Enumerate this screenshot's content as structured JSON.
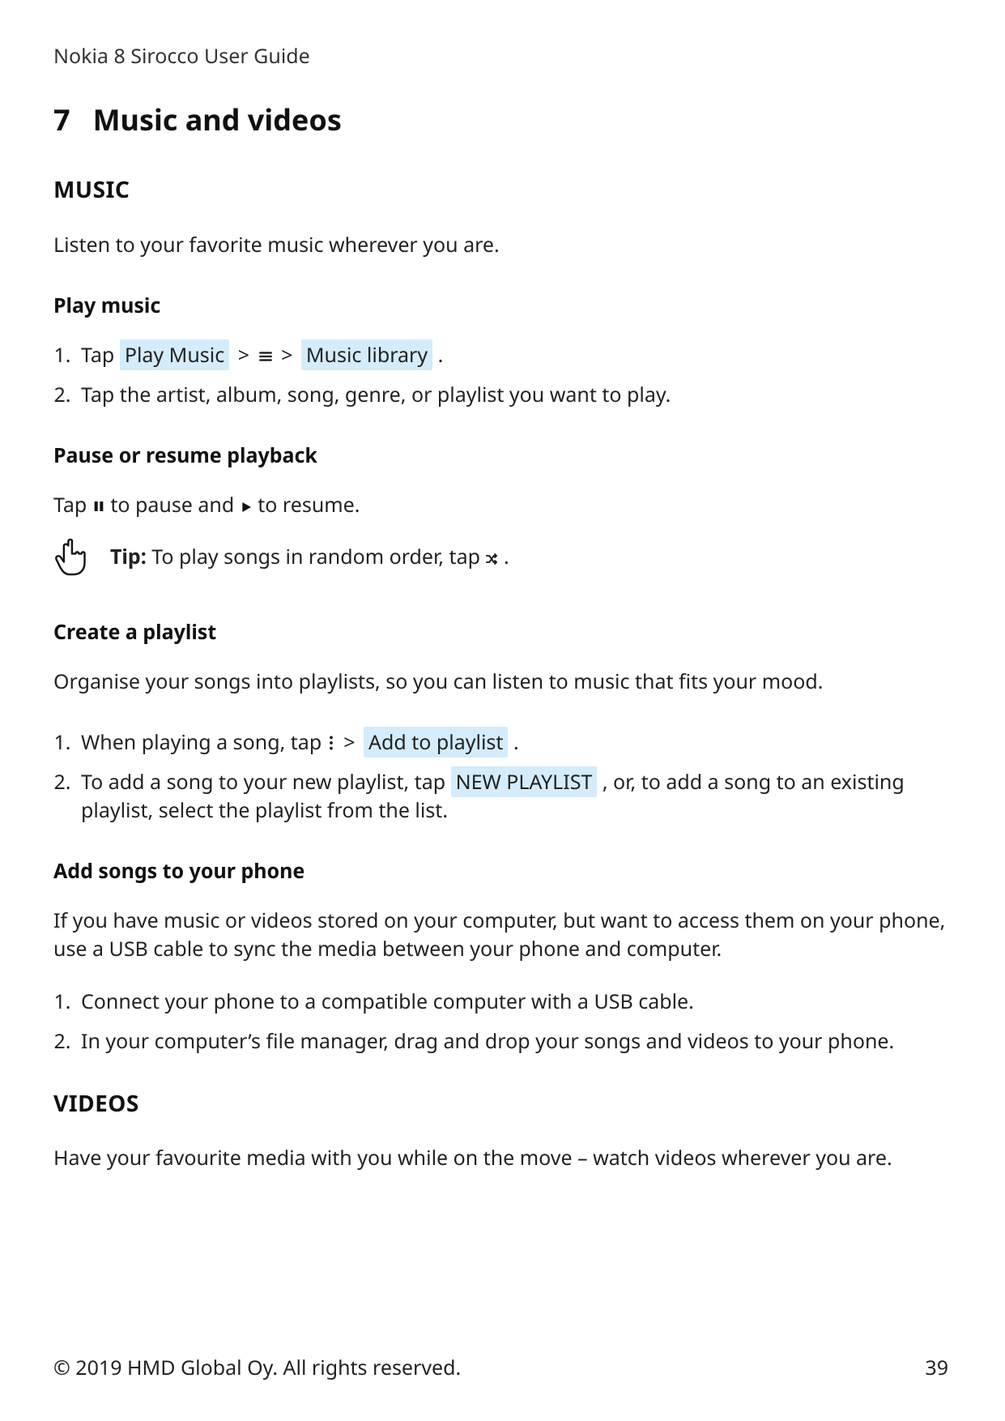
{
  "header": {
    "title": "Nokia 8 Sirocco User Guide"
  },
  "chapter": {
    "number": "7",
    "title": "Music and videos"
  },
  "music": {
    "heading": "MUSIC",
    "intro": "Listen to your favorite music wherever you are.",
    "play": {
      "heading": "Play music",
      "step1_prefix": "Tap ",
      "play_music_chip": "Play Music",
      "sep1": " > ",
      "menu_icon": "menu_equiv",
      "sep2": " > ",
      "music_library_chip": "Music library",
      "step1_suffix": " .",
      "step2": "Tap the artist, album, song, genre, or playlist you want to play."
    },
    "pause": {
      "heading": "Pause or resume playback",
      "line_prefix": "Tap ",
      "pause_icon": "pause",
      "line_mid": " to pause and ",
      "play_icon": "play",
      "line_suffix": " to resume."
    },
    "tip": {
      "label": "Tip:",
      "text_prefix": " To play songs in random order, tap ",
      "shuffle_icon": "shuffle",
      "text_suffix": "."
    },
    "playlist": {
      "heading": "Create a playlist",
      "intro": "Organise your songs into playlists, so you can listen to music that fits your mood.",
      "step1_prefix": "When playing a song, tap ",
      "vdots_icon": "more_vert",
      "sep": " > ",
      "add_to_playlist_chip": "Add to playlist",
      "step1_suffix": " .",
      "step2_prefix": "To add a song to your new playlist, tap ",
      "new_playlist_chip": "NEW PLAYLIST",
      "step2_suffix": " , or, to add a song to an existing playlist, select the playlist from the list."
    },
    "addsongs": {
      "heading": "Add songs to your phone",
      "intro": "If you have music or videos stored on your computer, but want to access them on your phone, use a USB cable to sync the media between your phone and computer.",
      "step1": "Connect your phone to a compatible computer with a USB cable.",
      "step2": "In your computer’s file manager, drag and drop your songs and videos to your phone."
    }
  },
  "videos": {
    "heading": "VIDEOS",
    "intro": "Have your favourite media with you while on the move – watch videos wherever you are."
  },
  "footer": {
    "copyright": "© 2019 HMD Global Oy. All rights reserved.",
    "page": "39"
  }
}
